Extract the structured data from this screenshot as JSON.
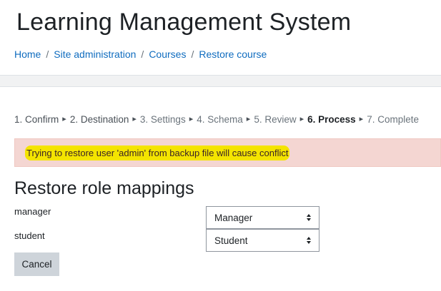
{
  "header": {
    "title": "Learning Management System",
    "breadcrumb": [
      "Home",
      "Site administration",
      "Courses",
      "Restore course"
    ],
    "separator": "/"
  },
  "steps": {
    "arrow": "▸",
    "items": [
      {
        "label": "1. Confirm",
        "state": "done"
      },
      {
        "label": "2. Destination",
        "state": "done"
      },
      {
        "label": "3. Settings",
        "state": "future"
      },
      {
        "label": "4. Schema",
        "state": "future"
      },
      {
        "label": "5. Review",
        "state": "future"
      },
      {
        "label": "6. Process",
        "state": "current"
      },
      {
        "label": "7. Complete",
        "state": "future"
      }
    ]
  },
  "alert": {
    "message": "Trying to restore user 'admin' from backup file will cause conflict",
    "bg_color": "#f4d6d2",
    "highlight_color": "#f4e400"
  },
  "role_mappings": {
    "heading": "Restore role mappings",
    "rows": [
      {
        "label": "manager",
        "selected": "Manager"
      },
      {
        "label": "student",
        "selected": "Student"
      }
    ]
  },
  "actions": {
    "cancel_label": "Cancel"
  },
  "colors": {
    "link": "#0f6cbf",
    "page_bg": "#f1f2f3"
  }
}
